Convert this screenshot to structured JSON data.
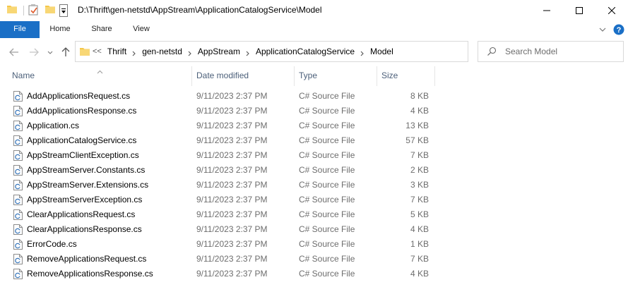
{
  "window": {
    "title": "D:\\Thrift\\gen-netstd\\AppStream\\ApplicationCatalogService\\Model"
  },
  "icons": {
    "folder": "folder-icon",
    "properties": "properties-check-icon",
    "new_folder": "new-folder-icon",
    "customize": "customize-quick-access-icon",
    "minimize": "minimize-icon",
    "maximize": "maximize-icon",
    "close": "close-icon",
    "back": "back-arrow-icon",
    "forward": "forward-arrow-icon",
    "recent": "chevron-down-icon",
    "up": "up-arrow-icon",
    "refresh": "refresh-icon",
    "search": "search-icon",
    "help": "help-icon",
    "file": "csharp-file-icon"
  },
  "colors": {
    "file_tab": "#1a6fc6",
    "folder_yellow": "#f5c748",
    "header_text": "#4c607a",
    "meta_text": "#6d6d6d"
  },
  "ribbon": {
    "tabs": [
      "File",
      "Home",
      "Share",
      "View"
    ]
  },
  "address": {
    "overflow": "<<",
    "crumbs": [
      "Thrift",
      "gen-netstd",
      "AppStream",
      "ApplicationCatalogService",
      "Model"
    ]
  },
  "search": {
    "placeholder": "Search Model"
  },
  "columns": {
    "name": "Name",
    "date": "Date modified",
    "type": "Type",
    "size": "Size"
  },
  "files": [
    {
      "name": "AddApplicationsRequest.cs",
      "date": "9/11/2023 2:37 PM",
      "type": "C# Source File",
      "size": "8 KB"
    },
    {
      "name": "AddApplicationsResponse.cs",
      "date": "9/11/2023 2:37 PM",
      "type": "C# Source File",
      "size": "4 KB"
    },
    {
      "name": "Application.cs",
      "date": "9/11/2023 2:37 PM",
      "type": "C# Source File",
      "size": "13 KB"
    },
    {
      "name": "ApplicationCatalogService.cs",
      "date": "9/11/2023 2:37 PM",
      "type": "C# Source File",
      "size": "57 KB"
    },
    {
      "name": "AppStreamClientException.cs",
      "date": "9/11/2023 2:37 PM",
      "type": "C# Source File",
      "size": "7 KB"
    },
    {
      "name": "AppStreamServer.Constants.cs",
      "date": "9/11/2023 2:37 PM",
      "type": "C# Source File",
      "size": "2 KB"
    },
    {
      "name": "AppStreamServer.Extensions.cs",
      "date": "9/11/2023 2:37 PM",
      "type": "C# Source File",
      "size": "3 KB"
    },
    {
      "name": "AppStreamServerException.cs",
      "date": "9/11/2023 2:37 PM",
      "type": "C# Source File",
      "size": "7 KB"
    },
    {
      "name": "ClearApplicationsRequest.cs",
      "date": "9/11/2023 2:37 PM",
      "type": "C# Source File",
      "size": "5 KB"
    },
    {
      "name": "ClearApplicationsResponse.cs",
      "date": "9/11/2023 2:37 PM",
      "type": "C# Source File",
      "size": "4 KB"
    },
    {
      "name": "ErrorCode.cs",
      "date": "9/11/2023 2:37 PM",
      "type": "C# Source File",
      "size": "1 KB"
    },
    {
      "name": "RemoveApplicationsRequest.cs",
      "date": "9/11/2023 2:37 PM",
      "type": "C# Source File",
      "size": "7 KB"
    },
    {
      "name": "RemoveApplicationsResponse.cs",
      "date": "9/11/2023 2:37 PM",
      "type": "C# Source File",
      "size": "4 KB"
    }
  ]
}
